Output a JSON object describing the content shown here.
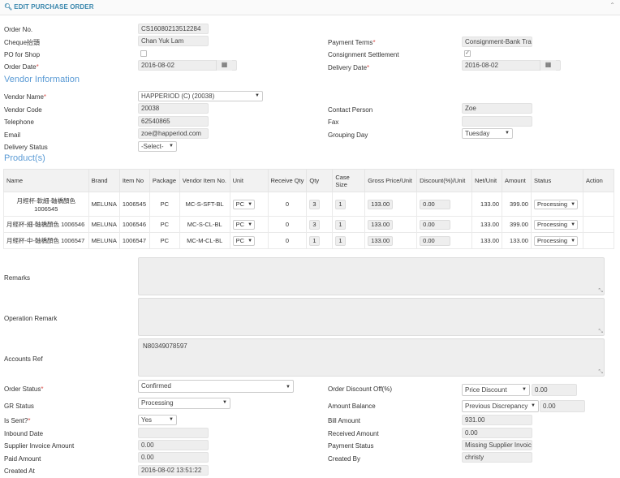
{
  "header": {
    "title": "EDIT PURCHASE ORDER",
    "collapse_icon": "chevron-up-icon"
  },
  "order": {
    "order_no_label": "Order No.",
    "order_no": "CS16080213512284",
    "cheque_label": "Cheque抬頭",
    "cheque": "Chan Yuk Lam",
    "po_for_shop_label": "PO for Shop",
    "order_date_label": "Order Date",
    "order_date": "2016-08-02",
    "payment_terms_label": "Payment Terms",
    "payment_terms": "Consignment-Bank Tran",
    "consignment_label": "Consignment Settlement",
    "delivery_date_label": "Delivery Date",
    "delivery_date": "2016-08-02",
    "required_mark": "*"
  },
  "vendor": {
    "section_title": "Vendor Information",
    "vendor_name_label": "Vendor Name",
    "vendor_name": "HAPPERIOD (C) (20038)",
    "vendor_code_label": "Vendor Code",
    "vendor_code": "20038",
    "telephone_label": "Telephone",
    "telephone": "62540865",
    "email_label": "Email",
    "email": "zoe@happeriod.com",
    "delivery_status_label": "Delivery Status",
    "delivery_status": "-Select-",
    "contact_person_label": "Contact Person",
    "contact_person": "Zoe",
    "fax_label": "Fax",
    "fax": "",
    "grouping_day_label": "Grouping Day",
    "grouping_day": "Tuesday"
  },
  "products": {
    "section_title": "Product(s)",
    "columns": [
      "Name",
      "Brand",
      "Item No",
      "Package",
      "Vendor Item No.",
      "Unit",
      "Receive Qty",
      "Qty",
      "Case Size",
      "Gross Price/Unit",
      "Discount(%)/Unit",
      "Net/Unit",
      "Amount",
      "Status",
      "Action"
    ],
    "rows": [
      {
        "name": "月經杯-軟細-軸橋顏色 1006545",
        "brand": "MELUNA",
        "item_no": "1006545",
        "package": "PC",
        "vendor_item_no": "MC-S-SFT-BL",
        "unit": "PC",
        "receive_qty": "0",
        "qty": "3",
        "case_size": "1",
        "gross_price": "133.00",
        "discount": "0.00",
        "net": "133.00",
        "amount": "399.00",
        "status": "Processing"
      },
      {
        "name": "月經杯-細-軸橋顏色 1006546",
        "brand": "MELUNA",
        "item_no": "1006546",
        "package": "PC",
        "vendor_item_no": "MC-S-CL-BL",
        "unit": "PC",
        "receive_qty": "0",
        "qty": "3",
        "case_size": "1",
        "gross_price": "133.00",
        "discount": "0.00",
        "net": "133.00",
        "amount": "399.00",
        "status": "Processing"
      },
      {
        "name": "月經杯-中-軸橋顏色 1006547",
        "brand": "MELUNA",
        "item_no": "1006547",
        "package": "PC",
        "vendor_item_no": "MC-M-CL-BL",
        "unit": "PC",
        "receive_qty": "0",
        "qty": "1",
        "case_size": "1",
        "gross_price": "133.00",
        "discount": "0.00",
        "net": "133.00",
        "amount": "133.00",
        "status": "Processing"
      }
    ]
  },
  "remarks": {
    "remarks_label": "Remarks",
    "remarks": "",
    "operation_remark_label": "Operation Remark",
    "operation_remark": "",
    "accounts_ref_label": "Accounts Ref",
    "accounts_ref": "N80349078597"
  },
  "summary": {
    "order_status_label": "Order Status",
    "order_status": "Confirmed",
    "gr_status_label": "GR Status",
    "gr_status": "Processing",
    "is_sent_label": "Is Sent?",
    "is_sent": "Yes",
    "inbound_date_label": "Inbound Date",
    "inbound_date": "",
    "supplier_invoice_amount_label": "Supplier Invoice Amount",
    "supplier_invoice_amount": "0.00",
    "paid_amount_label": "Paid Amount",
    "paid_amount": "0.00",
    "created_at_label": "Created At",
    "created_at": "2016-08-02 13:51:22",
    "order_discount_label": "Order Discount Off(%)",
    "order_discount_type": "Price Discount",
    "order_discount_value": "0.00",
    "amount_balance_label": "Amount Balance",
    "amount_balance_type": "Previous Discrepancy",
    "amount_balance_value": "0.00",
    "bill_amount_label": "Bill Amount",
    "bill_amount": "931.00",
    "received_amount_label": "Received Amount",
    "received_amount": "0.00",
    "payment_status_label": "Payment Status",
    "payment_status": "Missing Supplier Invoice",
    "created_by_label": "Created By",
    "created_by": "christy"
  }
}
